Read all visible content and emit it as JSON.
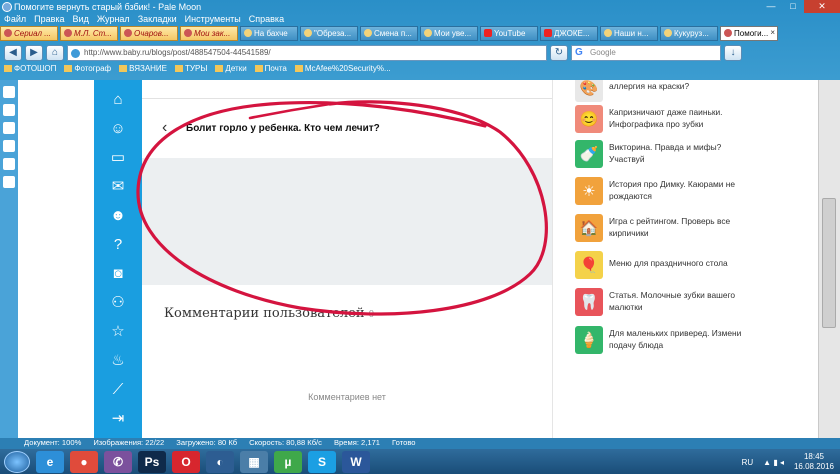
{
  "window": {
    "title": "Помогите вернуть старый бзбик! - Pale Moon",
    "controls": [
      "—",
      "□",
      "✕"
    ]
  },
  "menu": [
    "Файл",
    "Правка",
    "Вид",
    "Журнал",
    "Закладки",
    "Инструменты",
    "Справка"
  ],
  "tabs": [
    {
      "label": "Сериал ...",
      "style": "orange"
    },
    {
      "label": "М.Л. Ст...",
      "style": "orange"
    },
    {
      "label": "Очаров...",
      "style": "orange"
    },
    {
      "label": "Мои зак...",
      "style": "orange"
    },
    {
      "label": "На бахче",
      "style": "plain"
    },
    {
      "label": "\"Обреза...",
      "style": "plain"
    },
    {
      "label": "Смена п...",
      "style": "plain"
    },
    {
      "label": "Мои уве...",
      "style": "plain"
    },
    {
      "label": "YouTube",
      "style": "plain"
    },
    {
      "label": "ДЖОКЕ...",
      "style": "plain"
    },
    {
      "label": "Наши н...",
      "style": "plain"
    },
    {
      "label": "Кукуруз...",
      "style": "plain"
    },
    {
      "label": "Помоги...",
      "style": "active"
    }
  ],
  "nav": {
    "url": "http://www.baby.ru/blogs/post/488547504-44541589/",
    "search_placeholder": "Google",
    "search_engine": "G"
  },
  "bookmarks": [
    "ФОТОШОП",
    "Фотограф",
    "ВЯЗАНИЕ",
    "ТУРЫ",
    "Детки",
    "Почта",
    "McAfee%20Security%..."
  ],
  "post": {
    "title": "Болит горло у ребенка. Кто чем лечит?",
    "comments_heading": "Комментарии пользователей",
    "comments_count": "0",
    "no_comments": "Комментариев нет"
  },
  "sidebar": [
    {
      "text": "аллергия на краски?",
      "color": "#e8e8e8",
      "icon": "🎨"
    },
    {
      "text": "Капризничают даже паиньки. Инфографика про зубки",
      "color": "#f08a7a",
      "icon": "😊"
    },
    {
      "text": "Викторина. Правда и мифы? Участвуй",
      "color": "#33b66a",
      "icon": "🍼"
    },
    {
      "text": "История про Димку. Каюрами не рождаются",
      "color": "#f1a23c",
      "icon": "☀"
    },
    {
      "text": "Игра с рейтингом. Проверь все кирпичики",
      "color": "#f1a23c",
      "icon": "🏠"
    },
    {
      "text": "Меню для праздничного стола",
      "color": "#f4d24a",
      "icon": "🎈"
    },
    {
      "text": "Статья. Молочные зубки вашего малютки",
      "color": "#e8545a",
      "icon": "🦷"
    },
    {
      "text": "Для маленьких приверед. Измени подачу блюда",
      "color": "#33b66a",
      "icon": "🍦"
    }
  ],
  "statusbar": [
    "Документ: 100%",
    "Изображения: 22/22",
    "Загружено: 80 Кб",
    "Скорость: 80,88 Кб/с",
    "Время: 2,171",
    "Готово"
  ],
  "taskbar": {
    "apps": [
      {
        "name": "ie",
        "label": "e",
        "color": "#2d8fd8"
      },
      {
        "name": "chrome",
        "label": "●",
        "color": "#e04b3b"
      },
      {
        "name": "viber",
        "label": "✆",
        "color": "#7b519d"
      },
      {
        "name": "photoshop",
        "label": "Ps",
        "color": "#0f2a4a"
      },
      {
        "name": "opera",
        "label": "O",
        "color": "#d7262e"
      },
      {
        "name": "palemoon",
        "label": "◐",
        "color": "#2d5d92"
      },
      {
        "name": "calculator",
        "label": "▦",
        "color": "#4b7ea8"
      },
      {
        "name": "utorrent",
        "label": "µ",
        "color": "#3fa84a"
      },
      {
        "name": "skype",
        "label": "S",
        "color": "#1b9fe3"
      },
      {
        "name": "word",
        "label": "W",
        "color": "#2b579a"
      }
    ],
    "lang": "RU",
    "time": "18:45",
    "date": "16.08.2016"
  }
}
